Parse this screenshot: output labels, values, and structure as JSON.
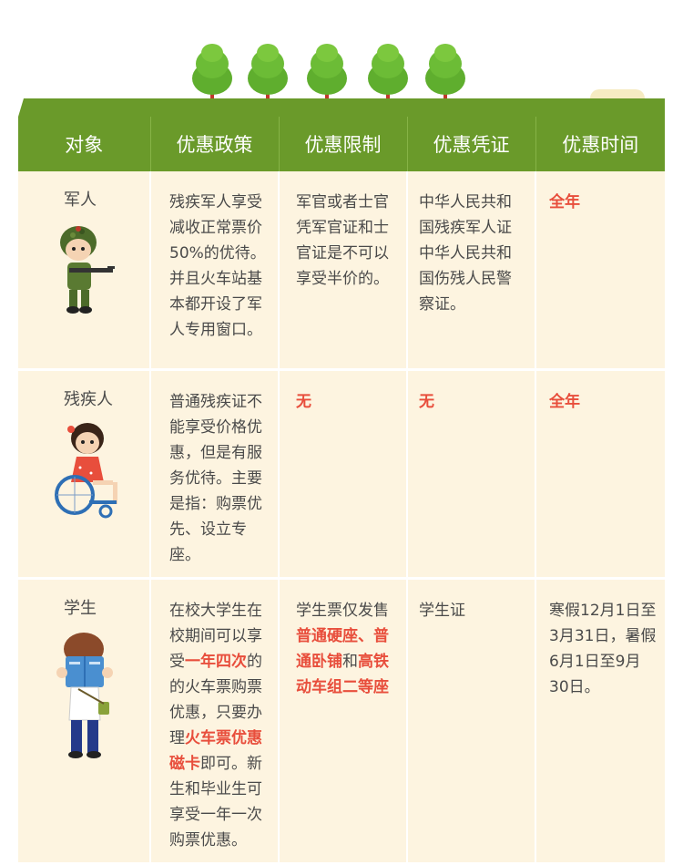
{
  "header": [
    "对象",
    "优惠政策",
    "优惠限制",
    "优惠凭证",
    "优惠时间"
  ],
  "rows": {
    "military": {
      "target": "军人",
      "policy": "残疾军人享受减收正常票价50%的优待。并且火车站基本都开设了军人专用窗口。",
      "limit": "军官或者士官凭军官证和士官证是不可以享受半价的。",
      "proof": "中华人民共和国残疾军人证中华人民共和国伤残人民警察证。",
      "time": "全年"
    },
    "disabled": {
      "target": "残疾人",
      "policy": "普通残疾证不能享受价格优惠，但是有服务优待。主要是指：购票优先、设立专座。",
      "limit": "无",
      "proof": "无",
      "time": "全年"
    },
    "student": {
      "target": "学生",
      "policy_parts": [
        "在校大学生在校期间可以享受",
        "一年四次",
        "的的火车票购票优惠，只要办理",
        "火车票优惠磁卡",
        "即可。新生和毕业生可享受一年一次购票优惠。"
      ],
      "limit_parts": [
        "学生票仅发售",
        "普通硬座、普通卧铺",
        "和",
        "高铁动车组二等座"
      ],
      "proof": "学生证",
      "time": "寒假12月1日至3月31日，暑假6月1日至9月30日。"
    }
  },
  "colors": {
    "header_green": "#6a9a2a",
    "cell_bg": "#fdf4e0",
    "highlight_red": "#e84e3c",
    "tree_green": "#5fae2e",
    "trunk": "#c0392b"
  }
}
